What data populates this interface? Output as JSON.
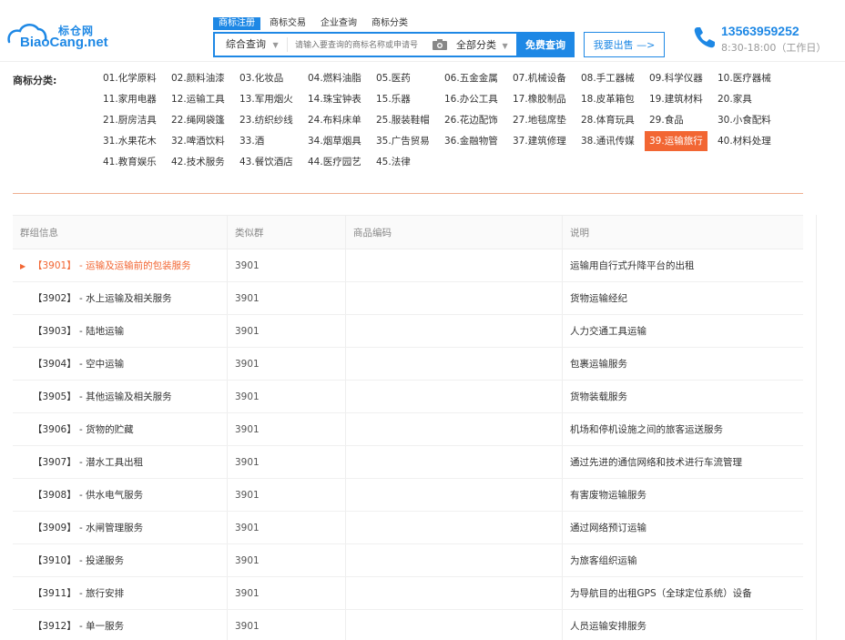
{
  "logo": {
    "cn": "标仓网",
    "en": "BiaoCang.net"
  },
  "search": {
    "tabs": [
      {
        "label": "商标注册",
        "active": true
      },
      {
        "label": "商标交易",
        "active": false
      },
      {
        "label": "企业查询",
        "active": false
      },
      {
        "label": "商标分类",
        "active": false
      }
    ],
    "scope": "综合查询",
    "placeholder": "请输入要查询的商标名称或申请号",
    "category": "全部分类",
    "button": "免费查询"
  },
  "sell_button": "我要出售 —>",
  "contact": {
    "phone": "13563959252",
    "hours": "8:30-18:00（工作日）"
  },
  "categories": {
    "label": "商标分类:",
    "items": [
      "01.化学原料",
      "02.颜料油漆",
      "03.化妆品",
      "04.燃料油脂",
      "05.医药",
      "06.五金金属",
      "07.机械设备",
      "08.手工器械",
      "09.科学仪器",
      "10.医疗器械",
      "11.家用电器",
      "12.运输工具",
      "13.军用烟火",
      "14.珠宝钟表",
      "15.乐器",
      "16.办公工具",
      "17.橡胶制品",
      "18.皮革箱包",
      "19.建筑材料",
      "20.家具",
      "21.厨房洁具",
      "22.绳网袋篷",
      "23.纺织纱线",
      "24.布料床单",
      "25.服装鞋帽",
      "26.花边配饰",
      "27.地毯席垫",
      "28.体育玩具",
      "29.食品",
      "30.小食配料",
      "31.水果花木",
      "32.啤酒饮料",
      "33.酒",
      "34.烟草烟具",
      "35.广告贸易",
      "36.金融物管",
      "37.建筑修理",
      "38.通讯传媒",
      "39.运输旅行",
      "40.材料处理",
      "41.教育娱乐",
      "42.技术服务",
      "43.餐饮酒店",
      "44.医疗园艺",
      "45.法律"
    ],
    "active_index": 38
  },
  "table": {
    "headers": [
      "群组信息",
      "类似群",
      "商品编码",
      "说明"
    ],
    "rows": [
      {
        "group": "【3901】 - 运输及运输前的包装服务",
        "similar": "3901",
        "code": "",
        "desc": "运输用自行式升降平台的出租"
      },
      {
        "group": "【3902】 - 水上运输及相关服务",
        "similar": "3901",
        "code": "",
        "desc": "货物运输经纪"
      },
      {
        "group": "【3903】 - 陆地运输",
        "similar": "3901",
        "code": "",
        "desc": "人力交通工具运输"
      },
      {
        "group": "【3904】 - 空中运输",
        "similar": "3901",
        "code": "",
        "desc": "包裹运输服务"
      },
      {
        "group": "【3905】 - 其他运输及相关服务",
        "similar": "3901",
        "code": "",
        "desc": "货物装载服务"
      },
      {
        "group": "【3906】 - 货物的贮藏",
        "similar": "3901",
        "code": "",
        "desc": "机场和停机设施之间的旅客运送服务"
      },
      {
        "group": "【3907】 - 潜水工具出租",
        "similar": "3901",
        "code": "",
        "desc": "通过先进的通信网络和技术进行车流管理"
      },
      {
        "group": "【3908】 - 供水电气服务",
        "similar": "3901",
        "code": "",
        "desc": "有害废物运输服务"
      },
      {
        "group": "【3909】 - 水闸管理服务",
        "similar": "3901",
        "code": "",
        "desc": "通过网络预订运输"
      },
      {
        "group": "【3910】 - 投递服务",
        "similar": "3901",
        "code": "",
        "desc": "为旅客组织运输"
      },
      {
        "group": "【3911】 - 旅行安排",
        "similar": "3901",
        "code": "",
        "desc": "为导航目的出租GPS（全球定位系统）设备"
      },
      {
        "group": "【3912】 - 单一服务",
        "similar": "3901",
        "code": "",
        "desc": "人员运输安排服务"
      }
    ],
    "active_row": 0
  },
  "colors": {
    "brand": "#1e88e5",
    "accent": "#f26633"
  }
}
